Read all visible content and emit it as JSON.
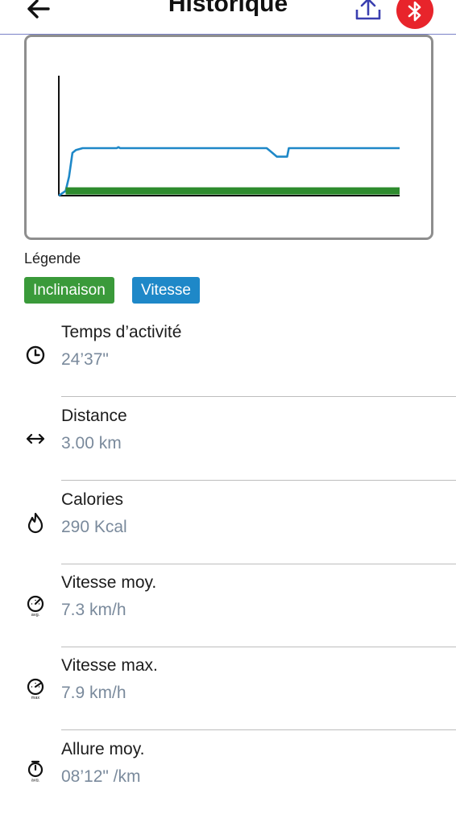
{
  "header": {
    "title": "Historique",
    "back_icon": "arrow-left-icon",
    "share_icon": "share-upload-icon",
    "bluetooth_icon": "bluetooth-icon",
    "accent": "#3a3fb0",
    "bluetooth_color": "#e8242b"
  },
  "chart_data": {
    "type": "line",
    "title": "",
    "xlabel": "",
    "ylabel": "",
    "grid": false,
    "series": [
      {
        "name": "Vitesse",
        "color": "#1e88c8",
        "points": [
          [
            0.0,
            0
          ],
          [
            0.02,
            5
          ],
          [
            0.03,
            20
          ],
          [
            0.04,
            45
          ],
          [
            0.05,
            48
          ],
          [
            0.07,
            50
          ],
          [
            0.17,
            50
          ],
          [
            0.175,
            51
          ],
          [
            0.18,
            50
          ],
          [
            0.32,
            50
          ],
          [
            0.45,
            50
          ],
          [
            0.61,
            50
          ],
          [
            0.62,
            47
          ],
          [
            0.64,
            41
          ],
          [
            0.67,
            41
          ],
          [
            0.675,
            50
          ],
          [
            1.0,
            50
          ]
        ]
      },
      {
        "name": "Inclinaison",
        "color": "#2e8b2e",
        "points": [
          [
            0.02,
            5
          ],
          [
            1.0,
            5
          ]
        ]
      }
    ]
  },
  "legend": {
    "title": "Légende",
    "items": [
      {
        "label": "Inclinaison",
        "color": "#3a9a3a"
      },
      {
        "label": "Vitesse",
        "color": "#1e88c8"
      }
    ]
  },
  "stats": [
    {
      "icon": "clock-icon",
      "label": "Temps d’activité",
      "value": "24’37\""
    },
    {
      "icon": "distance-arrows-icon",
      "label": "Distance",
      "value": "3.00 km"
    },
    {
      "icon": "flame-icon",
      "label": "Calories",
      "value": "290 Kcal"
    },
    {
      "icon": "speedometer-avg-icon",
      "label": "Vitesse moy.",
      "value": "7.3 km/h"
    },
    {
      "icon": "speedometer-max-icon",
      "label": "Vitesse max.",
      "value": "7.9 km/h"
    },
    {
      "icon": "stopwatch-avg-icon",
      "label": "Allure moy.",
      "value": "08’12\" /km"
    }
  ]
}
